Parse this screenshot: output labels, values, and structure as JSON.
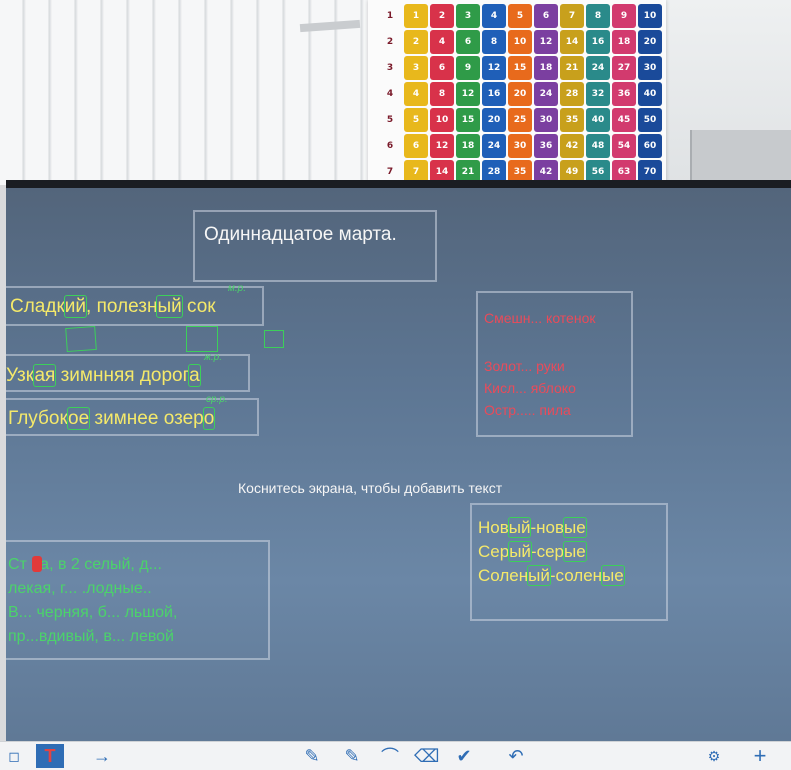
{
  "poster": {
    "row_labels": [
      "1",
      "2",
      "3",
      "4",
      "5",
      "6",
      "7"
    ],
    "cells": [
      [
        "1",
        "2",
        "3",
        "4",
        "5",
        "6",
        "7",
        "8",
        "9",
        "10"
      ],
      [
        "2",
        "4",
        "6",
        "8",
        "10",
        "12",
        "14",
        "16",
        "18",
        "20"
      ],
      [
        "3",
        "6",
        "9",
        "12",
        "15",
        "18",
        "21",
        "24",
        "27",
        "30"
      ],
      [
        "4",
        "8",
        "12",
        "16",
        "20",
        "24",
        "28",
        "32",
        "36",
        "40"
      ],
      [
        "5",
        "10",
        "15",
        "20",
        "25",
        "30",
        "35",
        "40",
        "45",
        "50"
      ],
      [
        "6",
        "12",
        "18",
        "24",
        "30",
        "36",
        "42",
        "48",
        "54",
        "60"
      ],
      [
        "7",
        "14",
        "21",
        "28",
        "35",
        "42",
        "49",
        "56",
        "63",
        "70"
      ]
    ],
    "colors": [
      "#e8b81c",
      "#d8324a",
      "#2f9b48",
      "#1f5fb8",
      "#e86a1c",
      "#7b3fa0",
      "#c8a01c",
      "#2a8a8a",
      "#d23a6e",
      "#1a4a9a"
    ]
  },
  "board": {
    "title": "Одиннадцатое марта.",
    "left_lines": [
      {
        "prefix": "Сладк",
        "hl": "ий",
        "rest": ", полезн",
        "hl2": "ый",
        "rest2": " сок"
      },
      {
        "prefix": "Узк",
        "hl": "ая",
        "rest": " зимнняя дорог",
        "hl2": "а",
        "rest2": ""
      },
      {
        "prefix": "Глубок",
        "hl": "ое",
        "rest": " зимнее озер",
        "hl2": "о",
        "rest2": ""
      }
    ],
    "annotations": [
      "м.р.",
      "ж.р.",
      "ср.р."
    ],
    "red_lines": [
      "Смешн... котенок",
      "",
      "Золот... руки",
      "Кисл... яблоко",
      "Остр..... пила"
    ],
    "hint": "Коснитесь экрана, чтобы добавить текст",
    "right_pairs": [
      {
        "a": "Нов",
        "b": "ый",
        "c": "-нов",
        "d": "ые"
      },
      {
        "a": "Сер",
        "b": "ый",
        "c": "-сер",
        "d": "ые"
      },
      {
        "a": "Солен",
        "b": "ый",
        "c": "-солен",
        "d": "ые"
      }
    ],
    "green_lines": [
      "Ст на, в 2 селый, д...",
      "лекая, г... .лодные..",
      "В... черняя, б... льшой,",
      "пр...вдивый, в... левой"
    ]
  },
  "toolbar": {
    "items": [
      {
        "name": "select-tool-icon",
        "glyph": "◻"
      },
      {
        "name": "text-tool-icon",
        "glyph": "T"
      },
      {
        "name": "arrow-tool-icon",
        "glyph": "→"
      },
      {
        "name": "pen-icon",
        "glyph": "✎"
      },
      {
        "name": "marker-icon",
        "glyph": "✎"
      },
      {
        "name": "lasso-icon",
        "glyph": "⌒"
      },
      {
        "name": "eraser-icon",
        "glyph": "⌫"
      },
      {
        "name": "check-icon",
        "glyph": "✔"
      },
      {
        "name": "undo-icon",
        "glyph": "↶"
      },
      {
        "name": "settings-icon",
        "glyph": "⚙"
      },
      {
        "name": "add-icon",
        "glyph": "+"
      }
    ]
  }
}
